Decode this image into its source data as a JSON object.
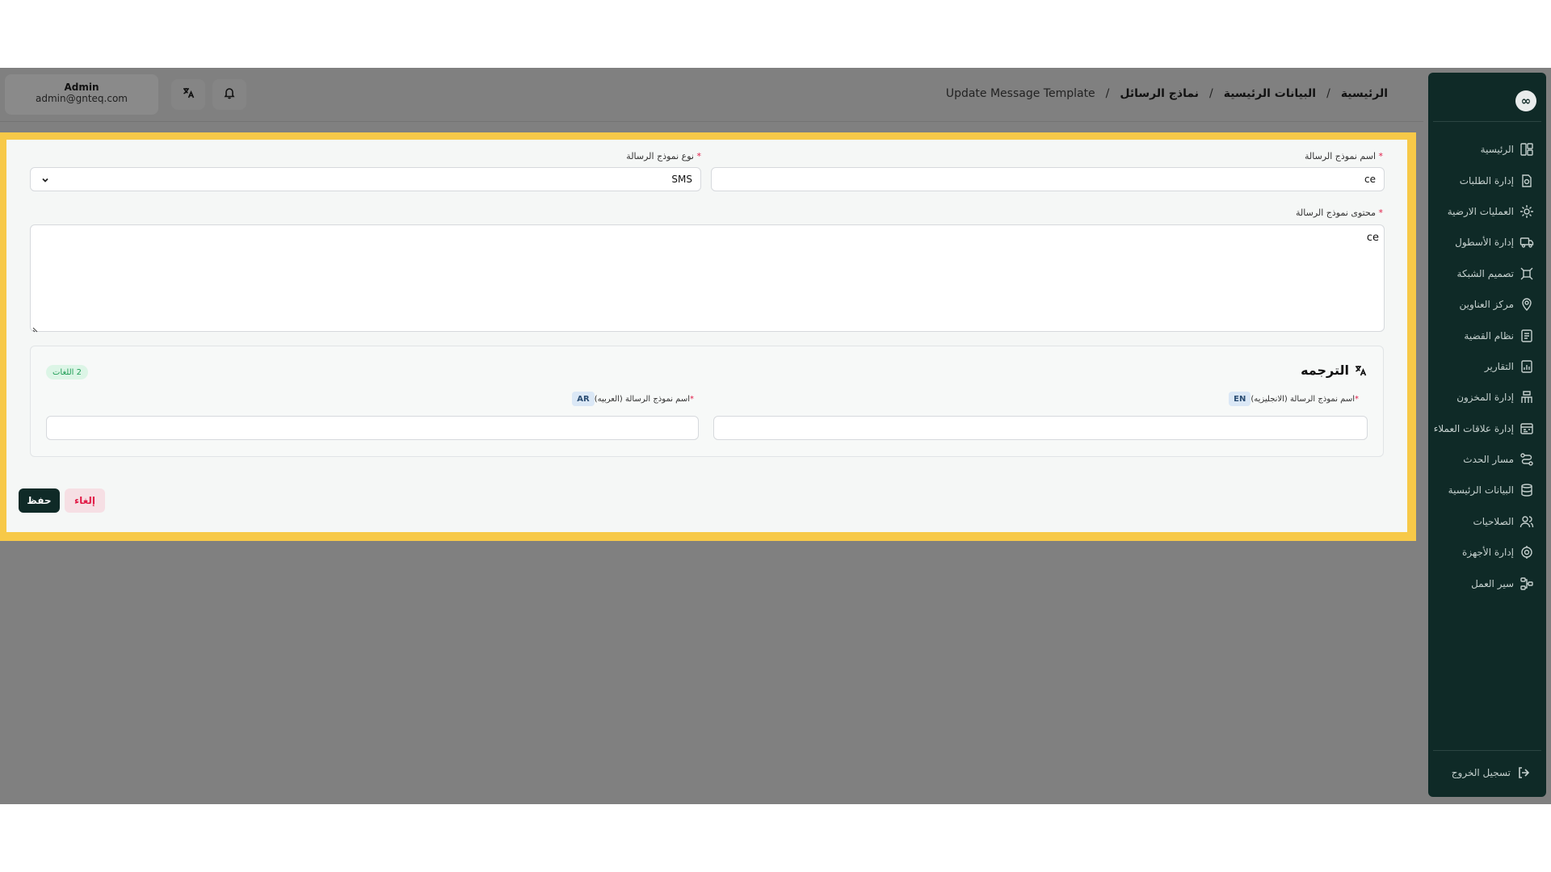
{
  "header": {
    "user": {
      "name": "Admin",
      "email": "admin@gnteq.com"
    },
    "breadcrumb": [
      "الرئيسية",
      "البيانات الرئيسية",
      "نماذج الرسائل",
      "Update Message Template"
    ]
  },
  "sidebar": {
    "items": [
      {
        "label": "الرئيسية",
        "icon": "dashboard-icon"
      },
      {
        "label": "إدارة الطلبات",
        "icon": "orders-icon"
      },
      {
        "label": "العمليات الارضية",
        "icon": "ground-ops-icon"
      },
      {
        "label": "إدارة الأسطول",
        "icon": "truck-icon"
      },
      {
        "label": "تصميم الشبكة",
        "icon": "network-icon"
      },
      {
        "label": "مركز العناوين",
        "icon": "location-icon"
      },
      {
        "label": "نظام القضية",
        "icon": "case-icon"
      },
      {
        "label": "التقارير",
        "icon": "reports-icon"
      },
      {
        "label": "إدارة المخزون",
        "icon": "inventory-icon"
      },
      {
        "label": "إدارة علاقات العملاء",
        "icon": "crm-icon"
      },
      {
        "label": "مسار الحدث",
        "icon": "event-path-icon"
      },
      {
        "label": "البيانات الرئيسية",
        "icon": "database-icon"
      },
      {
        "label": "الصلاحيات",
        "icon": "users-icon"
      },
      {
        "label": "إدارة الأجهزة",
        "icon": "devices-icon"
      },
      {
        "label": "سير العمل",
        "icon": "workflow-icon"
      }
    ],
    "logout": "تسجيل الخروج"
  },
  "form": {
    "name_label": "اسم نموذج الرسالة",
    "name_value": "ce",
    "type_label": "نوع نموذج الرسالة",
    "type_value": "SMS",
    "content_label": "محتوى نموذج الرسالة",
    "content_value": "ce",
    "translation": {
      "title": "الترجمه",
      "count": "2 اللغات",
      "en_badge": "EN",
      "en_label": "اسم نموذج الرسالة (الانجليزيه)",
      "en_value": "",
      "ar_badge": "AR",
      "ar_label": "اسم نموذج الرسالة (العربيه)",
      "ar_value": ""
    },
    "save_label": "حفظ",
    "cancel_label": "إلغاء"
  },
  "colors": {
    "highlight": "#f7c948",
    "sidebar": "#0f2a27",
    "required": "#e11d48"
  }
}
